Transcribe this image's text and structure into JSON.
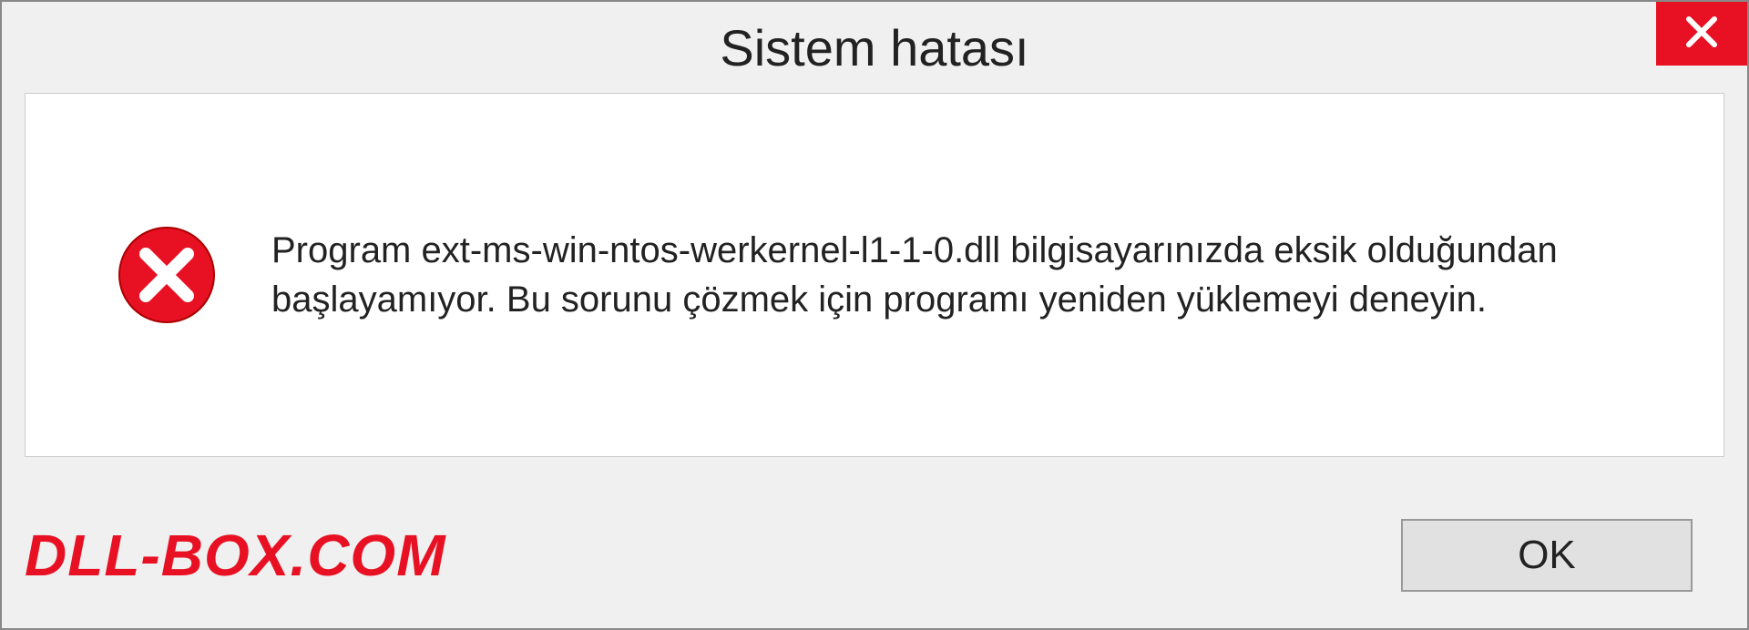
{
  "dialog": {
    "title": "Sistem hatası",
    "message": "Program ext-ms-win-ntos-werkernel-l1-1-0.dll bilgisayarınızda eksik olduğundan başlayamıyor. Bu sorunu çözmek için programı yeniden yüklemeyi deneyin.",
    "ok_label": "OK"
  },
  "watermark": "DLL-BOX.COM"
}
